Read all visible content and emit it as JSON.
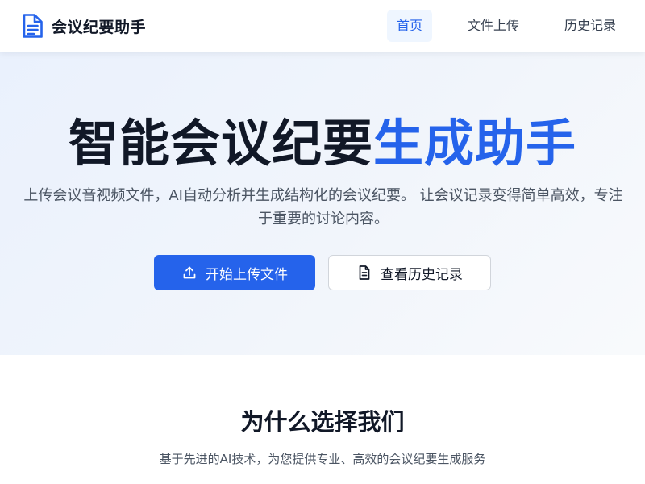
{
  "header": {
    "brand_name": "会议纪要助手",
    "nav": {
      "home": "首页",
      "upload": "文件上传",
      "history": "历史记录"
    },
    "active_nav": "home"
  },
  "hero": {
    "title_dark": "智能会议纪要",
    "title_accent": "生成助手",
    "description": "上传会议音视频文件，AI自动分析并生成结构化的会议纪要。 让会议记录变得简单高效，专注于重要的讨论内容。",
    "primary_button": "开始上传文件",
    "secondary_button": "查看历史记录"
  },
  "features": {
    "title": "为什么选择我们",
    "subtitle": "基于先进的AI技术，为您提供专业、高效的会议纪要生成服务"
  },
  "icons": {
    "brand": "document-icon",
    "primary_button": "upload-icon",
    "secondary_button": "document-text-icon"
  },
  "colors": {
    "accent": "#2563eb",
    "text_dark": "#111827",
    "text_muted": "#4b5563",
    "nav_active_bg": "#eff6ff"
  }
}
